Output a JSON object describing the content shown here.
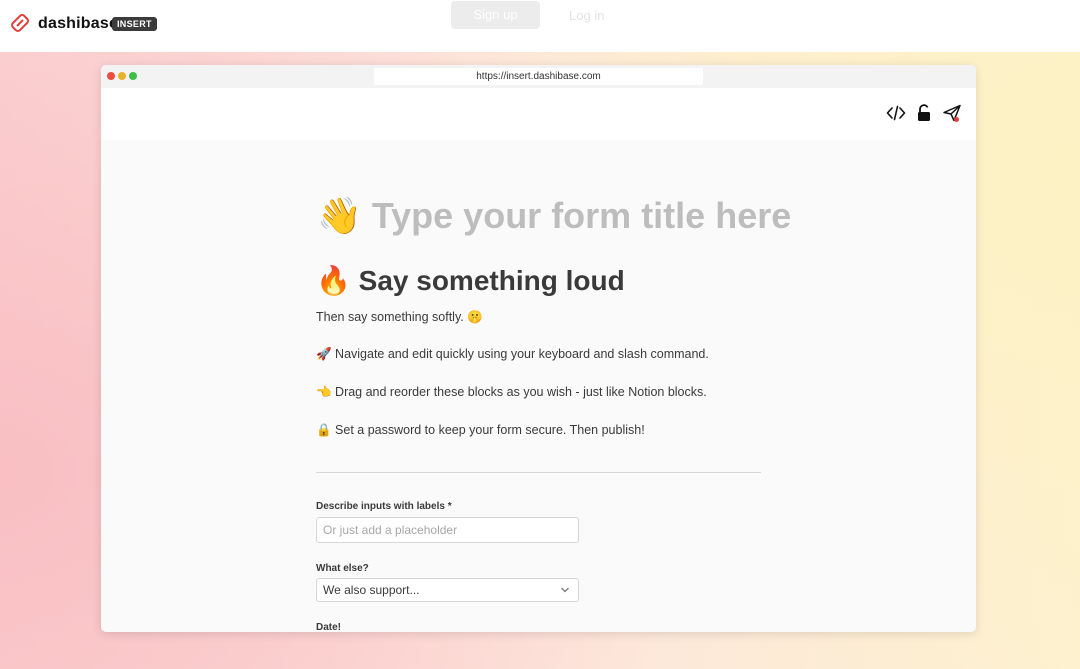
{
  "nav": {
    "brand": "dashibase",
    "badge": "INSERT",
    "signup_label": "Sign up",
    "login_label": "Log in"
  },
  "browser": {
    "url": "https://insert.dashibase.com"
  },
  "toolbar": {
    "icons": [
      "code-icon",
      "unlock-icon",
      "send-icon"
    ]
  },
  "form": {
    "title_placeholder": "👋 Type your form title here",
    "heading": "🔥 Say something loud",
    "paragraphs": [
      "Then say something softly. 🤫",
      "🚀 Navigate and edit quickly using your keyboard and slash command.",
      "👈 Drag and reorder these blocks as you wish - just like Notion blocks.",
      "🔒 Set a password to keep your form secure. Then publish!"
    ],
    "fields": [
      {
        "label": "Describe inputs with labels *",
        "placeholder": "Or just add a placeholder"
      },
      {
        "label": "What else?",
        "value": "We also support..."
      },
      {
        "label": "Date!"
      }
    ]
  },
  "colors": {
    "brand": "#e0403a",
    "title_placeholder": "#bdbdbd",
    "text": "#3a3a3a"
  }
}
